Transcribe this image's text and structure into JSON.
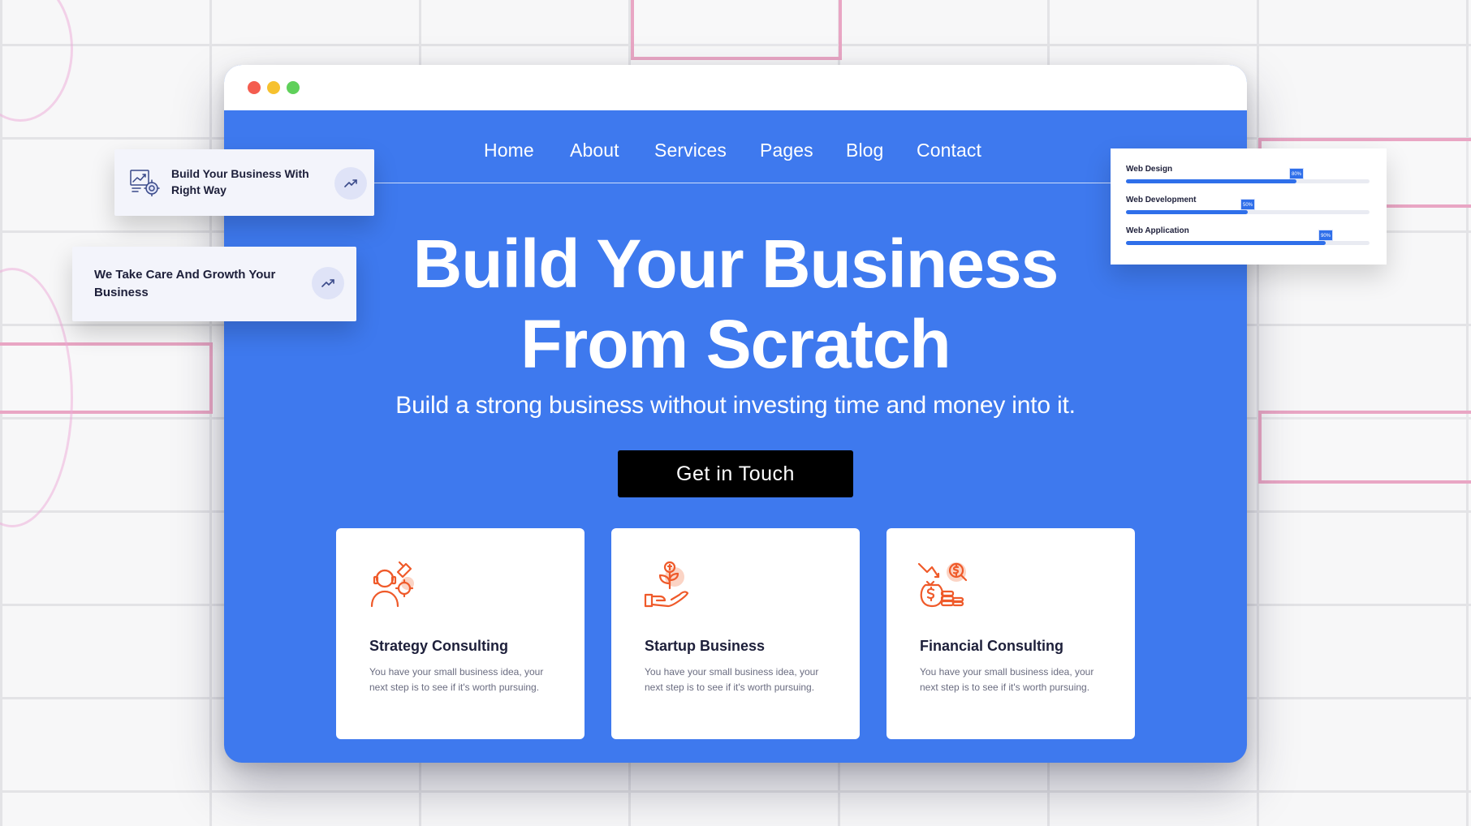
{
  "nav": {
    "items": [
      "Home",
      "About",
      "Services",
      "Pages",
      "Blog",
      "Contact"
    ]
  },
  "hero": {
    "title_line1": "Build Your Business",
    "title_line2": "From Scratch",
    "subtitle": "Build a strong business without investing time and money into it.",
    "cta_label": "Get in Touch"
  },
  "cards": [
    {
      "icon": "consulting-icon",
      "title": "Strategy Consulting",
      "description": "You have your small business idea, your next step is to see if it's worth pursuing."
    },
    {
      "icon": "startup-plant-icon",
      "title": "Startup Business",
      "description": "You have your small business idea, your next step is to see if it's worth pursuing."
    },
    {
      "icon": "financial-money-icon",
      "title": "Financial Consulting",
      "description": "You have your small business idea, your next step is to see if it's worth pursuing."
    }
  ],
  "float_cards": [
    {
      "text": "Build Your Business With Right Way",
      "icon": "analytics-icon",
      "action_icon": "trending-up-icon"
    },
    {
      "text": "We Take Care And Growth Your Business",
      "action_icon": "trending-up-icon"
    }
  ],
  "skills": [
    {
      "label": "Web Design",
      "percent": 70,
      "badge": "80%"
    },
    {
      "label": "Web Development",
      "percent": 50,
      "badge": "50%"
    },
    {
      "label": "Web Application",
      "percent": 82,
      "badge": "90%"
    }
  ],
  "colors": {
    "hero_blue": "#3e79ee",
    "accent_orange": "#ef5a2a",
    "progress_blue": "#2f6fea",
    "cta_black": "#000000"
  }
}
